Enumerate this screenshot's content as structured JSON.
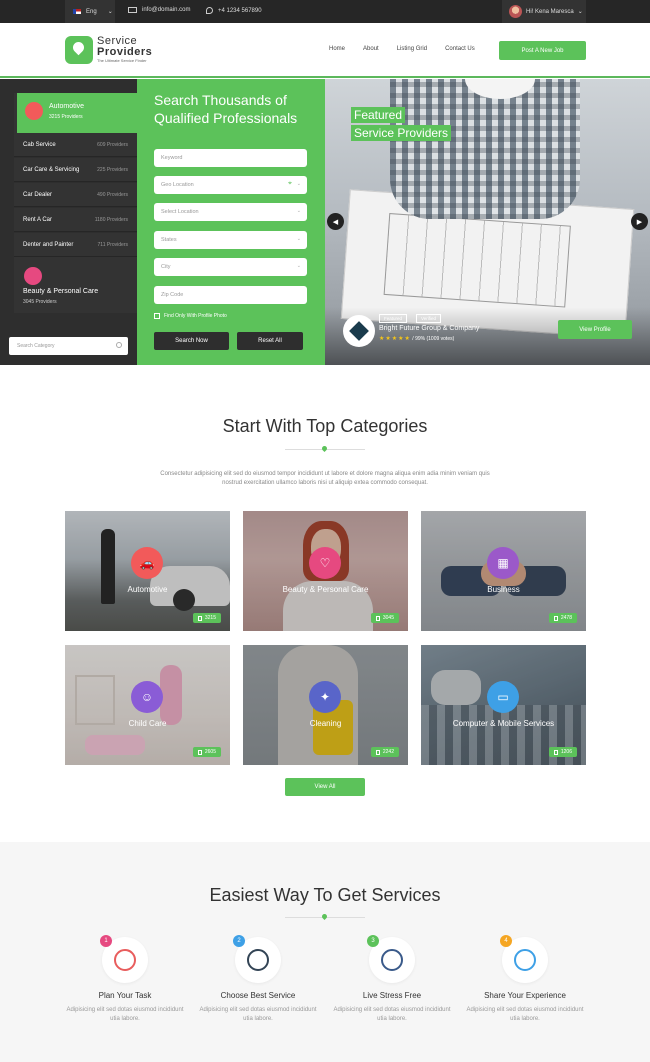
{
  "topbar": {
    "lang": "Eng",
    "email": "info@domain.com",
    "phone": "+4 1234 567890",
    "user": "Hi! Kena Maresca"
  },
  "header": {
    "logo_line1": "Service",
    "logo_line2": "Providers",
    "logo_tagline": "The Ultimate Service Finder",
    "nav": [
      "Home",
      "About",
      "Listing Grid",
      "Contact Us"
    ],
    "post_button": "Post A New Job"
  },
  "sidebar": {
    "active": {
      "label": "Automotive",
      "sub": "3215 Providers"
    },
    "items": [
      {
        "label": "Cab Service",
        "count": "609 Providers"
      },
      {
        "label": "Car Care & Servicing",
        "count": "225 Providers"
      },
      {
        "label": "Car Dealer",
        "count": "490 Providers"
      },
      {
        "label": "Rent A Car",
        "count": "1180 Providers"
      },
      {
        "label": "Denter and Painter",
        "count": "711 Providers"
      }
    ],
    "beauty": {
      "label": "Beauty & Personal Care",
      "sub": "3045 Providers"
    },
    "search_placeholder": "Search Category"
  },
  "search": {
    "title": "Search Thousands of Qualified Professionals",
    "fields": [
      "Keyword",
      "Geo Location",
      "Select Location",
      "States",
      "City",
      "Zip Code"
    ],
    "checkbox": "Find Only With Profile Photo",
    "search_btn": "Search Now",
    "reset_btn": "Reset All"
  },
  "featured": {
    "title1": "Featured",
    "title2": "Service Providers",
    "tag1": "Featured",
    "tag2": "Verified",
    "company": "Bright Future Group & Company",
    "stars": "★★★★★",
    "rating": "/ 99% (1009 votes)",
    "button": "View Profile"
  },
  "categories": {
    "title": "Start With Top Categories",
    "lead": "Consectetur adipisicing elit sed do eiusmod tempor incididunt ut labore et dolore magna aliqua enim adia minim veniam quis nostrud exercitation ullamco laboris nisi ut aliquip extea commodo consequat.",
    "cards": [
      {
        "title": "Automotive",
        "count": "3215",
        "color": "#f25a5a",
        "icon": "car-icon"
      },
      {
        "title": "Beauty & Personal Care",
        "count": "3045",
        "color": "#e64980",
        "icon": "heart-icon"
      },
      {
        "title": "Business",
        "count": "2478",
        "color": "#9b59c9",
        "icon": "building-icon"
      },
      {
        "title": "Child Care",
        "count": "2605",
        "color": "#8a5cd6",
        "icon": "smile-icon"
      },
      {
        "title": "Cleaning",
        "count": "2242",
        "color": "#5965c9",
        "icon": "wand-icon"
      },
      {
        "title": "Computer & Mobile Services",
        "count": "1206",
        "color": "#3ea0e6",
        "icon": "laptop-icon"
      }
    ],
    "view_all": "View All"
  },
  "steps": {
    "title": "Easiest Way To Get Services",
    "items": [
      {
        "num": "1",
        "title": "Plan Your Task",
        "desc": "Adipisicing elit sed dotas eiusmod incididunt utia labore.",
        "color": "#e64980"
      },
      {
        "num": "2",
        "title": "Choose Best Service",
        "desc": "Adipisicing elit sed dotas eiusmod incididunt utia labore.",
        "color": "#3ea0e6"
      },
      {
        "num": "3",
        "title": "Live Stress Free",
        "desc": "Adipisicing elit sed dotas eiusmod incididunt utia labore.",
        "color": "#5cc25a"
      },
      {
        "num": "4",
        "title": "Share Your Experience",
        "desc": "Adipisicing elit sed dotas eiusmod incididunt utia labore.",
        "color": "#f5a623"
      }
    ]
  }
}
